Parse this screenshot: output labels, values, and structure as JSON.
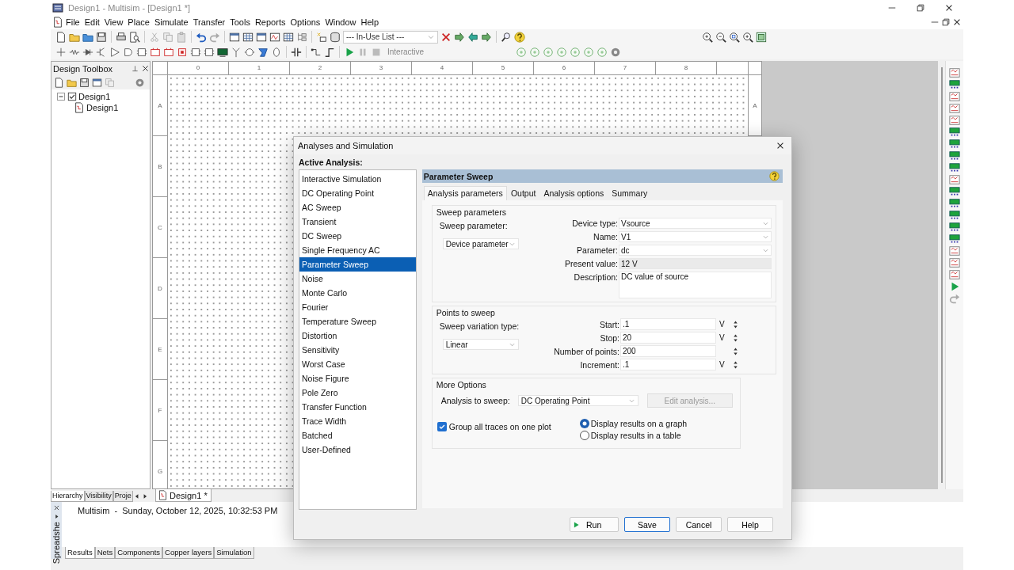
{
  "window": {
    "title": "Design1 - Multisim - [Design1 *]"
  },
  "menu": [
    "File",
    "Edit",
    "View",
    "Place",
    "Simulate",
    "Transfer",
    "Tools",
    "Reports",
    "Options",
    "Window",
    "Help"
  ],
  "toolbar": {
    "in_use_list": "--- In-Use List ---",
    "simulation_mode": "Interactive"
  },
  "design_toolbox": {
    "title": "Design Toolbox",
    "tree": [
      {
        "label": "Design1",
        "expanded": true,
        "checked": true,
        "children": [
          {
            "label": "Design1"
          }
        ]
      }
    ],
    "tabs": [
      {
        "label": "Hierarchy",
        "selected": true
      },
      {
        "label": "Visibility",
        "selected": false
      },
      {
        "label": "Proje",
        "selected": false
      }
    ]
  },
  "canvas": {
    "column_labels": [
      "0",
      "1",
      "2",
      "3",
      "4",
      "5",
      "6",
      "7",
      "8"
    ],
    "row_labels": [
      "A",
      "B",
      "C",
      "D",
      "E",
      "F",
      "G"
    ],
    "right_row_labels": [
      "A"
    ]
  },
  "document_tabs": [
    {
      "label": "Design1 *",
      "selected": true
    }
  ],
  "spreadsheet": {
    "title": "Spreadshe",
    "message": "Multisim  -  Sunday, October 12, 2025, 10:32:53 PM",
    "tabs": [
      {
        "label": "Results",
        "selected": true
      },
      {
        "label": "Nets",
        "selected": false
      },
      {
        "label": "Components",
        "selected": false
      },
      {
        "label": "Copper layers",
        "selected": false
      },
      {
        "label": "Simulation",
        "selected": false
      }
    ]
  },
  "dialog": {
    "title": "Analyses and Simulation",
    "list_label": "Active Analysis:",
    "analyses": [
      {
        "label": "Interactive Simulation",
        "selected": false
      },
      {
        "label": "DC Operating Point",
        "selected": false
      },
      {
        "label": "AC Sweep",
        "selected": false
      },
      {
        "label": "Transient",
        "selected": false
      },
      {
        "label": "DC Sweep",
        "selected": false
      },
      {
        "label": "Single Frequency AC",
        "selected": false
      },
      {
        "label": "Parameter Sweep",
        "selected": true
      },
      {
        "label": "Noise",
        "selected": false
      },
      {
        "label": "Monte Carlo",
        "selected": false
      },
      {
        "label": "Fourier",
        "selected": false
      },
      {
        "label": "Temperature Sweep",
        "selected": false
      },
      {
        "label": "Distortion",
        "selected": false
      },
      {
        "label": "Sensitivity",
        "selected": false
      },
      {
        "label": "Worst Case",
        "selected": false
      },
      {
        "label": "Noise Figure",
        "selected": false
      },
      {
        "label": "Pole Zero",
        "selected": false
      },
      {
        "label": "Transfer Function",
        "selected": false
      },
      {
        "label": "Trace Width",
        "selected": false
      },
      {
        "label": "Batched",
        "selected": false
      },
      {
        "label": "User-Defined",
        "selected": false
      }
    ],
    "panel_title": "Parameter Sweep",
    "tabs": [
      {
        "label": "Analysis parameters",
        "selected": true
      },
      {
        "label": "Output",
        "selected": false
      },
      {
        "label": "Analysis options",
        "selected": false
      },
      {
        "label": "Summary",
        "selected": false
      }
    ],
    "sweep_parameters": {
      "title": "Sweep parameters",
      "sweep_parameter_label": "Sweep parameter:",
      "sweep_parameter": "Device parameter",
      "fields": [
        {
          "label": "Device type:",
          "value": "Vsource",
          "kind": "dropdown"
        },
        {
          "label": "Name:",
          "value": "V1",
          "kind": "dropdown"
        },
        {
          "label": "Parameter:",
          "value": "dc",
          "kind": "dropdown"
        },
        {
          "label": "Present value:",
          "value": "12 V",
          "kind": "readonly"
        },
        {
          "label": "Description:",
          "value": "DC value of source",
          "kind": "memo"
        }
      ]
    },
    "points_to_sweep": {
      "title": "Points to sweep",
      "variation_label": "Sweep variation type:",
      "variation": "Linear",
      "fields": [
        {
          "label": "Start:",
          "value": ".1",
          "unit": "V"
        },
        {
          "label": "Stop:",
          "value": "20",
          "unit": "V"
        },
        {
          "label": "Number of points:",
          "value": "200"
        },
        {
          "label": "Increment:",
          "value": ".1",
          "unit": "V"
        }
      ]
    },
    "more_options": {
      "title": "More Options",
      "analysis_label": "Analysis to sweep:",
      "analysis": "DC Operating Point",
      "edit_button": {
        "label": "Edit analysis...",
        "disabled": true
      },
      "group_traces": {
        "label": "Group all traces on one plot",
        "checked": true
      },
      "display": [
        {
          "label": "Display results on a graph",
          "selected": true
        },
        {
          "label": "Display results in a table",
          "selected": false
        }
      ]
    },
    "buttons": [
      {
        "label": "Run",
        "kind": "run"
      },
      {
        "label": "Save",
        "kind": "default"
      },
      {
        "label": "Cancel",
        "kind": "plain"
      },
      {
        "label": "Help",
        "kind": "plain"
      }
    ]
  }
}
